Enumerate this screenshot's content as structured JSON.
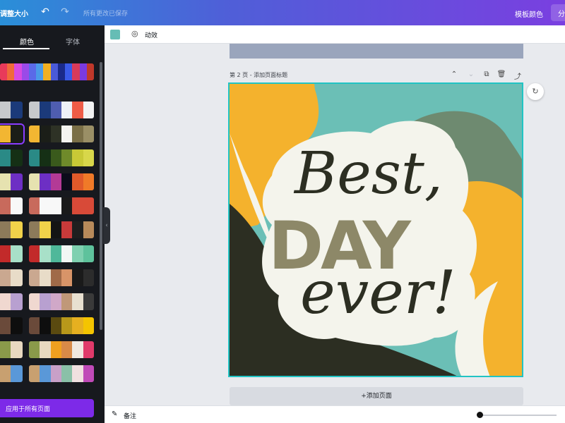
{
  "topbar": {
    "resize_label": "调整大小",
    "undo_icon": "undo-icon",
    "redo_icon": "redo-icon",
    "save_status": "所有更改已保存",
    "template_label": "模板",
    "color_label": "颜色",
    "share_label": "分"
  },
  "panel": {
    "tabs": [
      {
        "label": "颜色"
      },
      {
        "label": "字体"
      }
    ],
    "apply_all_label": "应用于所有页面",
    "palettes": [
      {
        "colors": [
          "#c7c9cc",
          "#1b3a7a",
          "#4f5db0",
          "#eef1f8",
          "#ee5c47",
          "#f2f2f2"
        ]
      },
      {
        "colors": [
          "#f2b632",
          "#1b1e18",
          "#2e3226",
          "#f4f4f0",
          "#7a6f47",
          "#9a8f66"
        ]
      },
      {
        "colors": [
          "#2a8a86",
          "#153015",
          "#3a5a1c",
          "#6f8a2a",
          "#c8c936",
          "#d8d74a"
        ]
      },
      {
        "colors": [
          "#e6e2b0",
          "#6d2fc4",
          "#b33a96",
          "#0b0b1a",
          "#e05a2a",
          "#f07a28"
        ]
      },
      {
        "colors": [
          "#c86a5c",
          "#f8f8f8",
          "#f8f8f8",
          "#1a1a1a",
          "#d84a38",
          "#d84a38"
        ]
      },
      {
        "colors": [
          "#8c7a5a",
          "#f1d24a",
          "#141414",
          "#c83a3a",
          "#1f1f1f",
          "#b88a5a"
        ]
      },
      {
        "colors": [
          "#c22a2a",
          "#a8e0c8",
          "#4fb89a",
          "#f2f7f4",
          "#7fd0b0",
          "#5ec29c"
        ]
      },
      {
        "colors": [
          "#caa890",
          "#e8dcc8",
          "#a06a48",
          "#d89468",
          "#1a1a1a",
          "#2c2c2c"
        ]
      },
      {
        "colors": [
          "#f0d8d0",
          "#b8a0d0",
          "#d0a8c8",
          "#c09878",
          "#e8e0d0",
          "#3a3a3a"
        ]
      },
      {
        "colors": [
          "#6a4a3a",
          "#0e0e0e",
          "#5a4a10",
          "#b8981a",
          "#e6b020",
          "#f4c400"
        ]
      },
      {
        "colors": [
          "#8a9a4a",
          "#e8d8c0",
          "#f0a020",
          "#d88a48",
          "#f0e8e0",
          "#e03a6a"
        ]
      },
      {
        "colors": [
          "#c8a070",
          "#5a98d8",
          "#c8a0c8",
          "#8ac0a8",
          "#f0e0e0",
          "#c04ab8"
        ]
      }
    ]
  },
  "swatches_strip": {
    "colors": [
      "#e83a5a",
      "#f06a3a",
      "#d84ae0",
      "#9a4ae8",
      "#5a6ae8",
      "#4a9ae8",
      "#f0b020",
      "#4a5ad8",
      "#1a2a8a",
      "#3a5ae8",
      "#d83a5a",
      "#7a3ae0",
      "#c0382a"
    ]
  },
  "subtoolbar": {
    "swatch_color": "#66bdb5",
    "animate_label": "动效"
  },
  "canvas": {
    "page_label": "第 2 页 - 添加页面标题",
    "add_page_label": "+添加页面",
    "design_text": {
      "line1": "Best,",
      "line2": "DAY",
      "line3": "ever!"
    },
    "colors": {
      "teal": "#6bbfb6",
      "yellow": "#f4b22d",
      "sage": "#6e8a70",
      "dark": "#2c2e22",
      "cream": "#f4f4ec",
      "olive": "#8d8868",
      "border": "#21c4c4"
    }
  },
  "bottombar": {
    "notes_label": "备注",
    "notes_icon": "notes-icon"
  }
}
